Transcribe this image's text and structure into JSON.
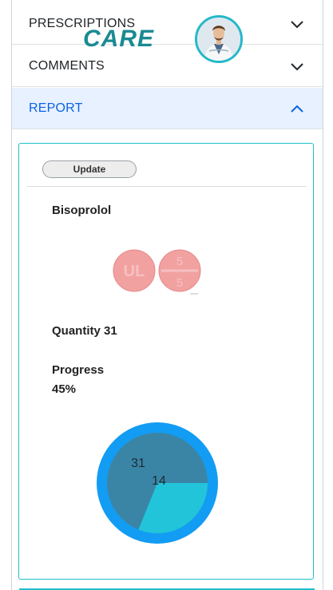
{
  "header": {
    "logo_text": "CARE",
    "avatar_icon": "doctor-avatar"
  },
  "accordion": {
    "prescriptions": {
      "label": "PRESCRIPTIONS",
      "icon": "chevron-down-icon"
    },
    "comments": {
      "label": "COMMENTS",
      "icon": "chevron-down-icon"
    },
    "report": {
      "label": "REPORT",
      "icon": "chevron-up-icon",
      "active": true
    }
  },
  "report": {
    "update_label": "Update",
    "medication_name": "Bisoprolol",
    "pill_marks": {
      "left": "UL",
      "right_top": "5",
      "right_bottom": "5"
    },
    "quantity_text": "Quantity 31",
    "progress_label": "Progress",
    "progress_value": "45%"
  },
  "chart_data": {
    "type": "pie",
    "values": [
      31,
      14
    ],
    "labels": [
      "31",
      "14"
    ],
    "colors": [
      "#3a85a6",
      "#22c4d9"
    ],
    "ring_color": "#139cf3"
  },
  "colors": {
    "accent": "#0c63e4",
    "active_bg": "#e7f1ff",
    "teal": "#20c0c8",
    "pill": "#f2a1a1"
  }
}
